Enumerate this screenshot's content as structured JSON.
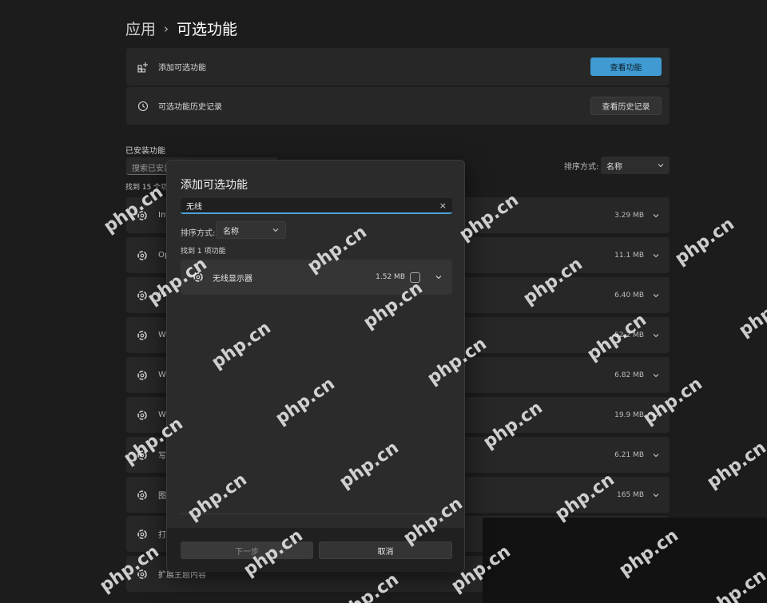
{
  "breadcrumb": {
    "parent": "应用",
    "current": "可选功能"
  },
  "cards": [
    {
      "label": "添加可选功能",
      "button": "查看功能"
    },
    {
      "label": "可选功能历史记录",
      "button": "查看历史记录"
    }
  ],
  "installed": {
    "title": "已安装功能",
    "search_placeholder": "搜索已安装",
    "sort_label": "排序方式:",
    "sort_value": "名称",
    "found": "找到 15 个功",
    "rows": [
      {
        "name": "Int",
        "size": "3.29 MB"
      },
      {
        "name": "Op",
        "size": "11.1 MB"
      },
      {
        "name": "Wi",
        "size": "6.40 MB"
      },
      {
        "name": "Wi",
        "size": "52.2 MB"
      },
      {
        "name": "Wi",
        "size": "6.82 MB"
      },
      {
        "name": "Wi",
        "size": "19.9 MB"
      },
      {
        "name": "写",
        "size": "6.21 MB"
      },
      {
        "name": "图",
        "size": "165 MB"
      },
      {
        "name": "打",
        "size": ""
      },
      {
        "name": "扩展主题内容",
        "size": ""
      }
    ]
  },
  "dialog": {
    "title": "添加可选功能",
    "search_value": "无线",
    "clear": "×",
    "sort_label": "排序方式:",
    "sort_value": "名称",
    "found": "找到 1 项功能",
    "result": {
      "name": "无线显示器",
      "size": "1.52 MB"
    },
    "next_label": "下一步",
    "cancel_label": "取消"
  },
  "watermark": "php.cn"
}
